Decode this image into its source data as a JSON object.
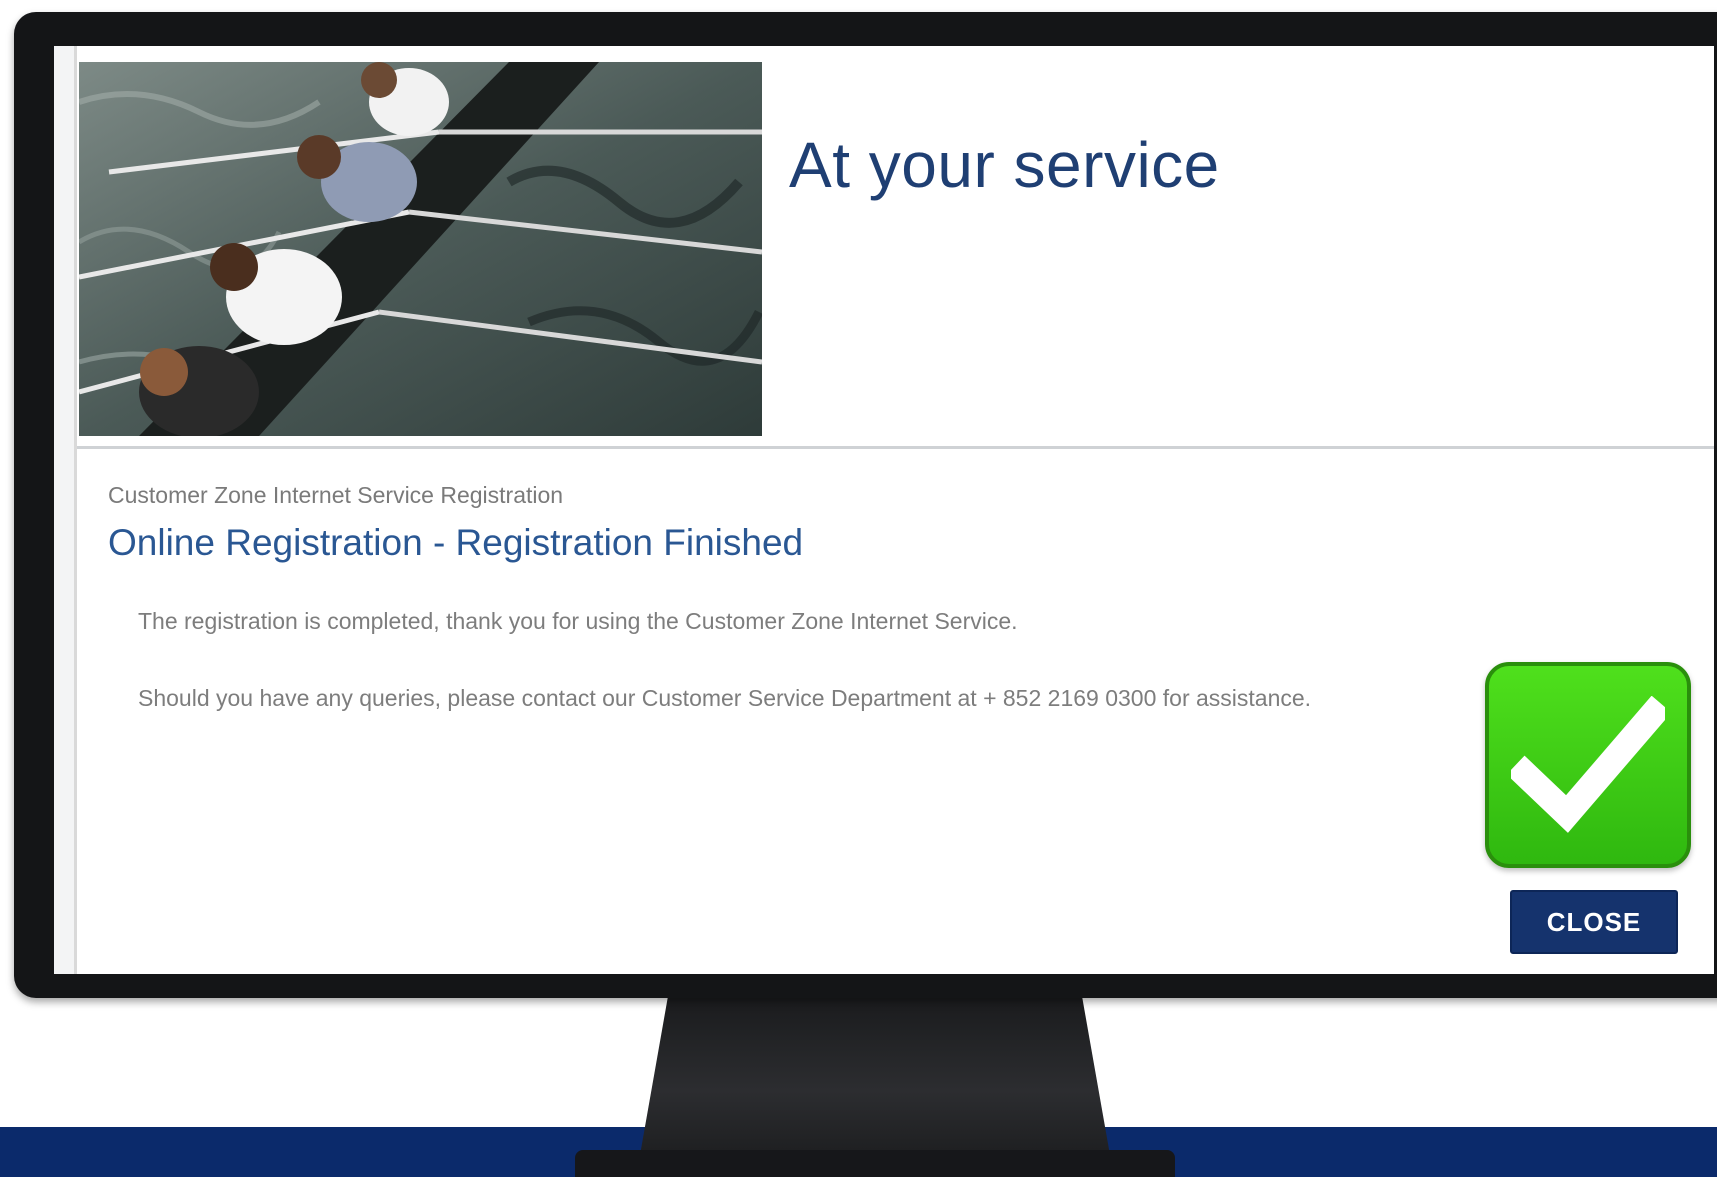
{
  "hero": {
    "title": "At your service",
    "photo_icon": "rowing-team-photo"
  },
  "content": {
    "breadcrumb": "Customer Zone Internet Service Registration",
    "heading": "Online Registration - Registration Finished",
    "message_completed": "The registration is completed, thank you for using the Customer Zone Internet Service.",
    "message_queries": "Should you have any queries, please contact our Customer Service Department at + 852 2169 0300 for assistance."
  },
  "actions": {
    "close_label": "CLOSE"
  },
  "overlay": {
    "icon": "checkmark-icon",
    "color": "#3ccf14"
  },
  "colors": {
    "brand_navy": "#15336d",
    "heading_blue": "#2a5793",
    "band": "#0b2a6b"
  }
}
